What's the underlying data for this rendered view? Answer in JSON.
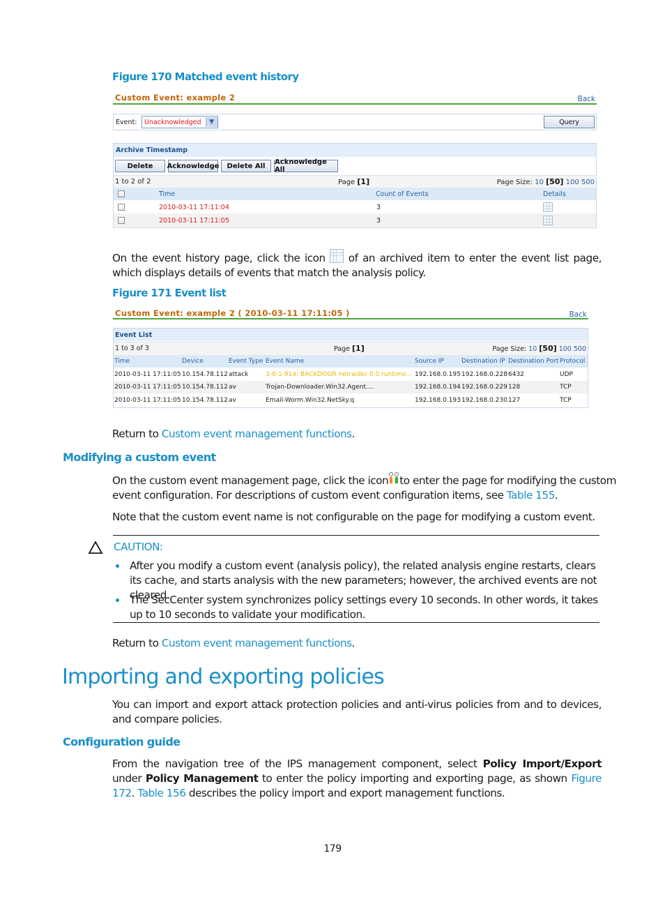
{
  "figure170": {
    "caption": "Figure 170 Matched event history",
    "ui": {
      "title": "Custom Event: example 2",
      "back_label": "Back",
      "filter": {
        "label": "Event:",
        "selected": "Unacknowledged",
        "query_label": "Query"
      },
      "panel_title": "Archive Timestamp",
      "buttons": [
        "Delete",
        "Acknowledge",
        "Delete All",
        "Acknowledge All"
      ],
      "pager": {
        "range": "1 to 2 of 2",
        "page_label": "Page",
        "page_current": "[1]",
        "size_label": "Page Size:",
        "sizes": [
          "10",
          "[50]",
          "100",
          "500"
        ]
      },
      "columns": [
        "Time",
        "Count of Events",
        "Details"
      ],
      "rows": [
        {
          "time": "2010-03-11 17:11:04",
          "count": "3"
        },
        {
          "time": "2010-03-11 17:11:05",
          "count": "3"
        }
      ]
    }
  },
  "para_event_history": {
    "before_icon": "On the event history page, click the icon",
    "after_icon": "of an archived item to enter the event list page, which displays details of events that match the analysis policy."
  },
  "figure171": {
    "caption": "Figure 171 Event list",
    "ui": {
      "title": "Custom Event: example 2 ( 2010-03-11 17:11:05 )",
      "back_label": "Back",
      "panel_title": "Event List",
      "pager": {
        "range": "1 to 3 of 3",
        "page_label": "Page",
        "page_current": "[1]",
        "size_label": "Page Size:",
        "sizes": [
          "10",
          "[50]",
          "100",
          "500"
        ]
      },
      "columns": [
        "Time",
        "Device",
        "Event Type",
        "Event Name",
        "Source IP",
        "Destination IP",
        "Destination Port",
        "Protocol"
      ],
      "rows": [
        {
          "time": "2010-03-11 17:11:05",
          "device": "10.154.78.112",
          "type": "attack",
          "name": "3-0-1-914: BACKDOOR netraider 0.0 runtime...",
          "src": "192.168.0.195",
          "dst": "192.168.0.228",
          "port": "6432",
          "proto": "UDP"
        },
        {
          "time": "2010-03-11 17:11:05",
          "device": "10.154.78.112",
          "type": "av",
          "name": "Trojan-Downloader.Win32.Agent....",
          "src": "192.168.0.194",
          "dst": "192.168.0.229",
          "port": "128",
          "proto": "TCP"
        },
        {
          "time": "2010-03-11 17:11:05",
          "device": "10.154.78.112",
          "type": "av",
          "name": "Email-Worm.Win32.NetSky.q",
          "src": "192.168.0.193",
          "dst": "192.168.0.230",
          "port": "127",
          "proto": "TCP"
        }
      ]
    }
  },
  "return1": {
    "prefix": "Return to ",
    "link": "Custom event management functions",
    "suffix": "."
  },
  "modifying": {
    "heading": "Modifying a custom event",
    "p1_before_icon": "On the custom event management page, click the icon",
    "p1_after_icon_line1": "to enter the page for modifying the custom",
    "p1_line2_prefix": "event configuration. For descriptions of custom event configuration items, see ",
    "p1_link": "Table 155",
    "p1_suffix": ".",
    "p2": "Note that the custom event name is not configurable on the page for modifying a custom event."
  },
  "caution": {
    "label": "CAUTION:",
    "items": [
      "After you modify a custom event (analysis policy), the related analysis engine restarts, clears its cache, and starts analysis with the new parameters; however, the archived events are not cleared.",
      "The SecCenter system synchronizes policy settings every 10 seconds. In other words, it takes up to 10 seconds to validate your modification."
    ]
  },
  "return2": {
    "prefix": "Return to ",
    "link": "Custom event management functions",
    "suffix": "."
  },
  "importing": {
    "heading": "Importing and exporting policies",
    "intro": "You can import and export attack protection policies and anti-virus policies from and to devices, and compare policies."
  },
  "config_guide": {
    "heading": "Configuration guide",
    "t1": "From the navigation tree of the IPS management component, select ",
    "b1": "Policy Import/Export",
    "t2": " under ",
    "b2": "Policy Management",
    "t3": " to enter the policy importing and exporting page, as shown ",
    "link1": "Figure 172",
    "t4": ". ",
    "link2": "Table 156",
    "t5": " describes the policy import and export management functions."
  },
  "page_number": "179"
}
